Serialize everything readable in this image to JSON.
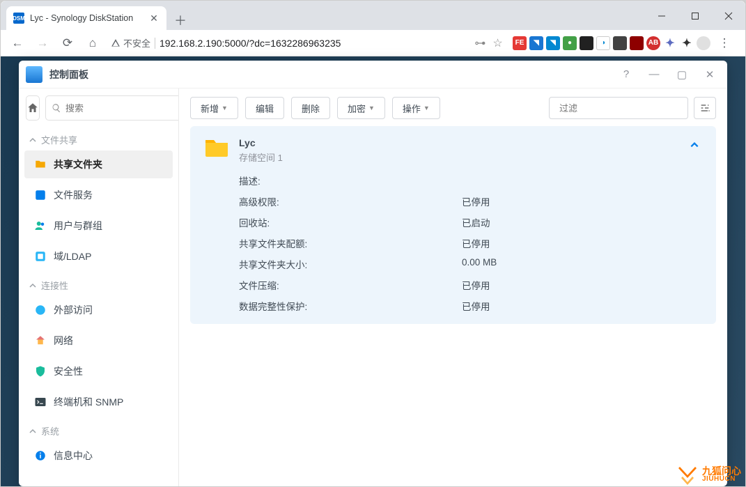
{
  "browser": {
    "tab_title": "Lyc - Synology DiskStation",
    "insecure_label": "不安全",
    "url": "192.168.2.190:5000/?dc=1632286963235",
    "favicon_text": "DSM"
  },
  "dsm": {
    "title": "控制面板"
  },
  "search": {
    "placeholder": "搜索"
  },
  "sidebar": {
    "sections": {
      "fileshare": "文件共享",
      "connectivity": "连接性",
      "system": "系统"
    },
    "items": {
      "shared_folder": "共享文件夹",
      "file_service": "文件服务",
      "users_groups": "用户与群组",
      "domain_ldap": "域/LDAP",
      "external_access": "外部访问",
      "network": "网络",
      "security": "安全性",
      "terminal_snmp": "终端机和 SNMP",
      "info_center": "信息中心"
    }
  },
  "toolbar": {
    "new": "新增",
    "edit": "编辑",
    "delete": "删除",
    "encrypt": "加密",
    "action": "操作",
    "filter_placeholder": "过滤"
  },
  "folder": {
    "name": "Lyc",
    "volume": "存储空间 1",
    "details": [
      {
        "label": "描述:",
        "value": ""
      },
      {
        "label": "高级权限:",
        "value": "已停用"
      },
      {
        "label": "回收站:",
        "value": "已启动"
      },
      {
        "label": "共享文件夹配额:",
        "value": "已停用"
      },
      {
        "label": "共享文件夹大小:",
        "value": "0.00 MB"
      },
      {
        "label": "文件压缩:",
        "value": "已停用"
      },
      {
        "label": "数据完整性保护:",
        "value": "已停用"
      }
    ]
  },
  "watermark": {
    "cn": "九狐问心",
    "en": "JIUHUCN"
  }
}
